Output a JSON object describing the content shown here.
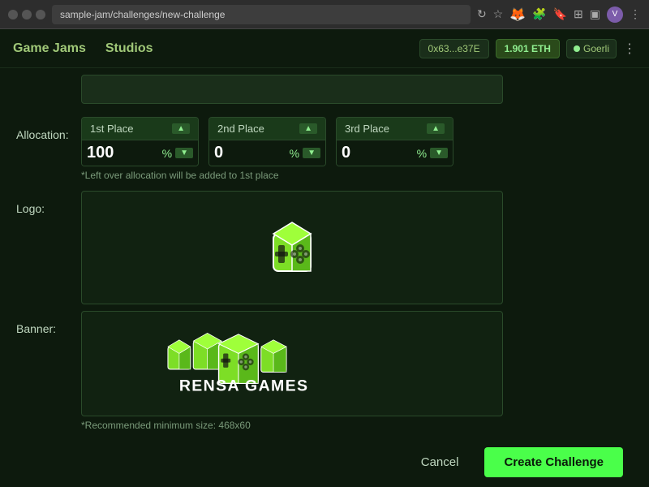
{
  "browser": {
    "url": "sample-jam/challenges/new-challenge",
    "profile_initial": "V"
  },
  "nav": {
    "link1": "Game Jams",
    "link2": "Studios",
    "wallet_address": "0x63...e37E",
    "wallet_balance": "1.901 ETH",
    "wallet_network": "Goerli",
    "wallet_menu_icon": "⋮"
  },
  "form": {
    "allocation_label": "Allocation:",
    "logo_label": "Logo:",
    "banner_label": "Banner:",
    "places": [
      {
        "label": "1st Place",
        "value": "100",
        "suffix": "%"
      },
      {
        "label": "2nd Place",
        "value": "0",
        "suffix": "%"
      },
      {
        "label": "3rd Place",
        "value": "0",
        "suffix": "%"
      }
    ],
    "allocation_note": "*Left over allocation will be added to 1st place",
    "rec_note": "*Recommended minimum size: 468x60"
  },
  "actions": {
    "cancel_label": "Cancel",
    "create_label": "Create Challenge"
  }
}
